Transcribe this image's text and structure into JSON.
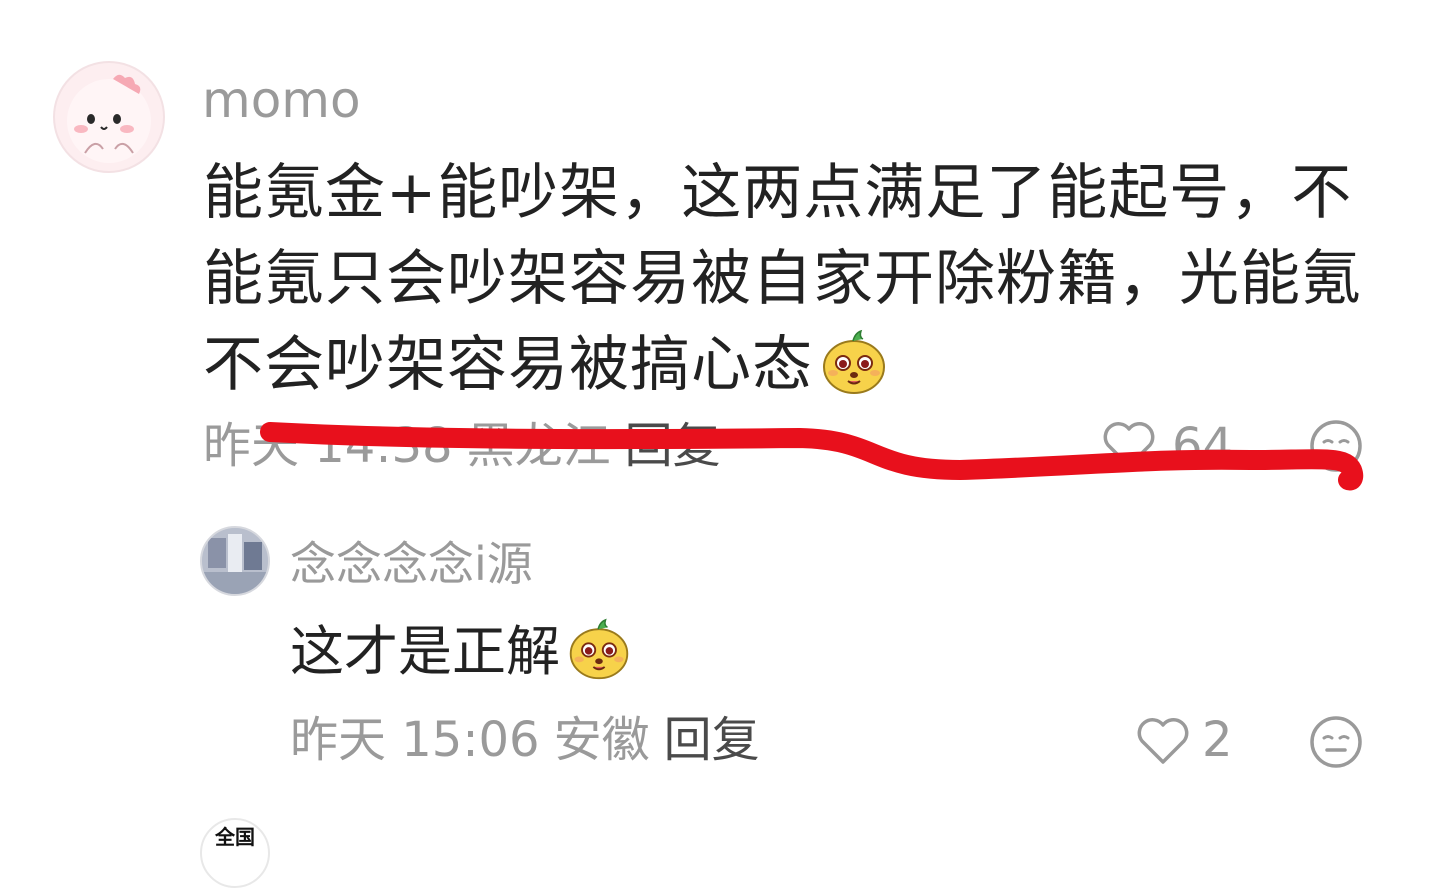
{
  "comment": {
    "username": "momo",
    "text": "能氪金+能吵架，这两点满足了能起号，不能氪只会吵架容易被自家开除粉籍，光能氪不会吵架容易被搞心态",
    "time": "昨天 14:38",
    "location": "黑龙江",
    "reply_label": "回复",
    "likes": "64",
    "emoji": "yellow-blob-emoji",
    "annotation_color": "#e8101c"
  },
  "reply": {
    "username": "念念念念i源",
    "text": "这才是正解",
    "time": "昨天 15:06",
    "location": "安徽",
    "reply_label": "回复",
    "likes": "2",
    "emoji": "yellow-blob-emoji"
  },
  "next_avatar": {
    "text": "全国"
  },
  "icons": {
    "like": "heart-outline-icon",
    "dislike": "meh-face-icon"
  }
}
